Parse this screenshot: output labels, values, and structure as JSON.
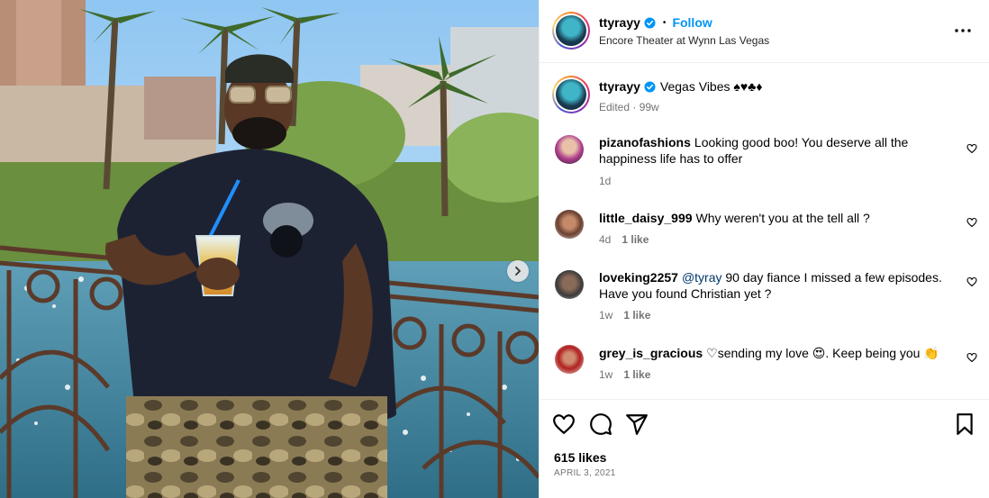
{
  "header": {
    "username": "ttyrayy",
    "separator": "•",
    "follow_label": "Follow",
    "location": "Encore Theater at Wynn Las Vegas"
  },
  "caption": {
    "username": "ttyrayy",
    "text": "Vegas Vibes ♠♥♣♦",
    "meta": "Edited · 99w"
  },
  "comments": [
    {
      "username": "pizanofashions",
      "text": "Looking good boo! You deserve all the happiness life has to offer",
      "time": "1d",
      "likes": ""
    },
    {
      "username": "little_daisy_999",
      "text": "Why weren't you at the tell all ?",
      "time": "4d",
      "likes": "1 like"
    },
    {
      "username": "loveking2257",
      "mention": "@tyray",
      "text": " 90 day fiance I missed a few episodes. Have you found Christian yet ?",
      "time": "1w",
      "likes": "1 like"
    },
    {
      "username": "grey_is_gracious",
      "text_before": "♡sending my love ",
      "emoji1": "😍",
      "text_after": ". Keep being you ",
      "emoji2": "👏",
      "time": "1w",
      "likes": "1 like"
    }
  ],
  "footer": {
    "likes": "615 likes",
    "date": "APRIL 3, 2021"
  },
  "icons": {
    "like": "heart-icon",
    "comment": "comment-icon",
    "share": "send-icon",
    "save": "bookmark-icon",
    "more": "more-icon",
    "next": "chevron-right-icon"
  },
  "colors": {
    "follow": "#0095f6",
    "verified": "#0095f6",
    "muted": "#737373"
  }
}
